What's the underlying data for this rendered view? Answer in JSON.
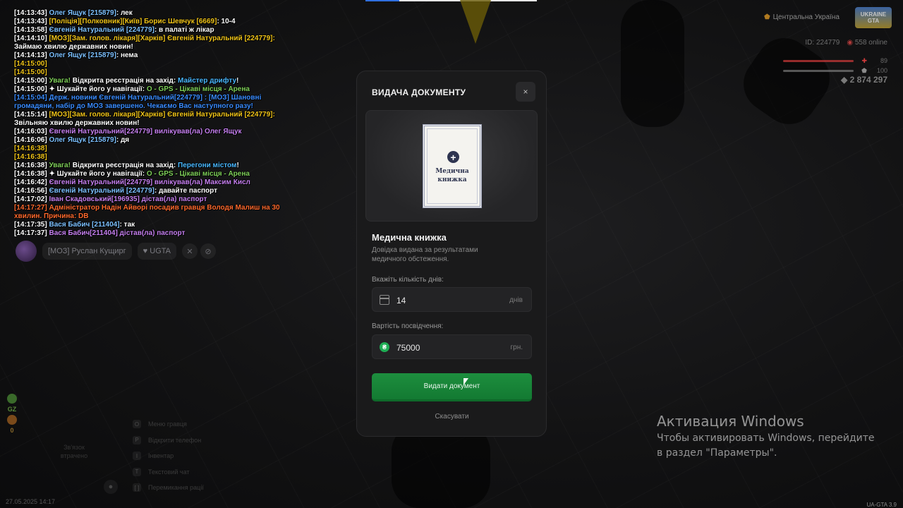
{
  "chat": [
    {
      "parts": [
        [
          "c-w",
          "[14:13:43] "
        ],
        [
          "c-b",
          "Олег Ящук [215879]"
        ],
        [
          "c-w",
          ": лек"
        ]
      ]
    },
    {
      "parts": [
        [
          "c-w",
          "[14:13:43] "
        ],
        [
          "c-y",
          "[Поліція][Полковник][Київ] Борис Шевчук [6669]"
        ],
        [
          "c-w",
          ": 10-4"
        ]
      ]
    },
    {
      "parts": [
        [
          "c-w",
          "[14:13:58] "
        ],
        [
          "c-b",
          "Євгеній Натуральний [224779]"
        ],
        [
          "c-w",
          ": в палаті ж лікар"
        ]
      ]
    },
    {
      "parts": [
        [
          "c-w",
          "[14:14:10] "
        ],
        [
          "c-y",
          "[МОЗ][Зам. голов. лікаря][Харків] Євгеній Натуральний [224779]:"
        ]
      ]
    },
    {
      "parts": [
        [
          "c-w",
          "Займаю хвилю державних новин!"
        ]
      ]
    },
    {
      "parts": [
        [
          "c-w",
          "[14:14:13] "
        ],
        [
          "c-b",
          "Олег Ящук [215879]"
        ],
        [
          "c-w",
          ": нема"
        ]
      ]
    },
    {
      "parts": [
        [
          "c-y",
          "[14:15:00]"
        ]
      ]
    },
    {
      "parts": [
        [
          "c-y",
          "[14:15:00]"
        ]
      ]
    },
    {
      "parts": [
        [
          "c-w",
          "[14:15:00] "
        ],
        [
          "c-g",
          "Увага! "
        ],
        [
          "c-w",
          "Відкрита реєстрація на захід: "
        ],
        [
          "c-c",
          "Майстер дрифту"
        ],
        [
          "c-w",
          "!"
        ]
      ]
    },
    {
      "parts": [
        [
          "c-w",
          "[14:15:00] ✦ Шукайте його у навігації: "
        ],
        [
          "c-g",
          "O - GPS - Цікаві місця - Арена"
        ]
      ]
    },
    {
      "wrap": true,
      "parts": [
        [
          "c-bd",
          "[14:15:04] Держ. новини Євгеній Натуральний[224779] : [МОЗ] Шановні громадяни, набір до МОЗ завершено. Чекаємо Вас наступного разу!"
        ]
      ]
    },
    {
      "parts": [
        [
          "c-w",
          "[14:15:14] "
        ],
        [
          "c-y",
          "[МОЗ][Зам. голов. лікаря][Харків] Євгеній Натуральний [224779]:"
        ]
      ]
    },
    {
      "parts": [
        [
          "c-w",
          "Звільняю хвилю державних новин!"
        ]
      ]
    },
    {
      "parts": [
        [
          "c-w",
          "[14:16:03] "
        ],
        [
          "c-p",
          "Євгеній Натуральний[224779] вилікував(ла) Олег Ящук"
        ]
      ]
    },
    {
      "parts": [
        [
          "c-w",
          "[14:16:06] "
        ],
        [
          "c-b",
          "Олег Ящук [215879]"
        ],
        [
          "c-w",
          ": дя"
        ]
      ]
    },
    {
      "parts": [
        [
          "c-y",
          "[14:16:38]"
        ]
      ]
    },
    {
      "parts": [
        [
          "c-y",
          "[14:16:38]"
        ]
      ]
    },
    {
      "parts": [
        [
          "c-w",
          "[14:16:38] "
        ],
        [
          "c-g",
          "Увага! "
        ],
        [
          "c-w",
          "Відкрита реєстрація на захід: "
        ],
        [
          "c-c",
          "Перегони містом"
        ],
        [
          "c-w",
          "!"
        ]
      ]
    },
    {
      "parts": [
        [
          "c-w",
          "[14:16:38] ✦ Шукайте його у навігації: "
        ],
        [
          "c-g",
          "O - GPS - Цікаві місця - Арена"
        ]
      ]
    },
    {
      "parts": [
        [
          "c-w",
          "[14:16:42] "
        ],
        [
          "c-p",
          "Євгеній Натуральний[224779] вилікував(ла) Максим Кисл"
        ]
      ]
    },
    {
      "parts": [
        [
          "c-w",
          "[14:16:56] "
        ],
        [
          "c-b",
          "Євгеній Натуральний [224779]"
        ],
        [
          "c-w",
          ": давайте паспорт"
        ]
      ]
    },
    {
      "parts": [
        [
          "c-w",
          "[14:17:02] "
        ],
        [
          "c-p",
          "Іван Скадовський[196935] дістав(ла) паспорт"
        ]
      ]
    },
    {
      "wrap": true,
      "parts": [
        [
          "c-r",
          "[14:17:27] Адміністратор Надін Айворі посадив гравця Володя Малиш на 30 хвилин. Причина: DB"
        ]
      ]
    },
    {
      "parts": [
        [
          "c-w",
          "[14:17:35] "
        ],
        [
          "c-b",
          "Вася Бабич [211404]"
        ],
        [
          "c-w",
          ": так"
        ]
      ]
    },
    {
      "parts": [
        [
          "c-w",
          "[14:17:37] "
        ],
        [
          "c-p",
          "Вася Бабич[211404] дістав(ла) паспорт"
        ]
      ]
    }
  ],
  "voice": {
    "name": "[МОЗ] Руслан Кущирг",
    "tag": "UGTA"
  },
  "hud": {
    "region": "Центральна Україна",
    "logo_top": "UKRAINE",
    "logo_bottom": "GTA",
    "id_text": "ID: 224779",
    "online": "558 online",
    "health": "89",
    "armor": "100",
    "money": "2 874 297",
    "health_color": "#d23b3b",
    "armor_color": "#8c8c8c"
  },
  "status": {
    "gz": "GZ",
    "count": "0"
  },
  "hints": [
    {
      "key": "O",
      "label": "Меню гравця"
    },
    {
      "key": "P",
      "label": "Відкрити телефон"
    },
    {
      "key": "I",
      "label": "Інвентар"
    },
    {
      "key": "T",
      "label": "Текстовий чат"
    },
    {
      "key": "[ ]",
      "label": "Перемикання рації"
    }
  ],
  "link_hint": "Зв'язок втрачено",
  "datetime": "27.05.2025 14:17",
  "version": "UA-GTA 3.9",
  "windows": {
    "title": "Активация Windows",
    "text": "Чтобы активировать Windows, перейдите в раздел \"Параметры\"."
  },
  "modal": {
    "title": "ВИДАЧА ДОКУМЕНТУ",
    "close": "×",
    "doc_card_text_1": "Медична",
    "doc_card_text_2": "книжка",
    "doc_name": "Медична книжка",
    "doc_desc": "Довідка видана за результатами медичного обстеження.",
    "days_label": "Вкажіть кількість днів:",
    "days_value": "14",
    "days_unit": "днів",
    "price_label": "Вартість посвідчення:",
    "price_value": "75000",
    "price_unit": "грн.",
    "currency_symbol": "₴",
    "issue_button": "Видати документ",
    "cancel_button": "Скасувати",
    "accent_color": "#1d8e3e"
  }
}
